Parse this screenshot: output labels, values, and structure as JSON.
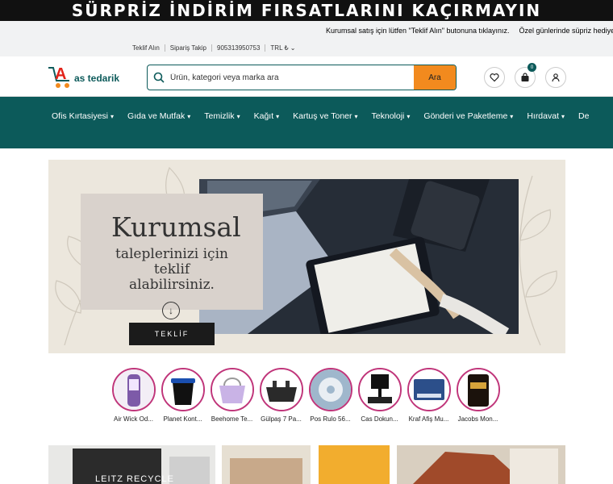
{
  "banner": {
    "text": "SÜRPRİZ İNDİRİM FIRSATLARINI KAÇIRMAYIN"
  },
  "ticker": [
    {
      "text": "Kurumsal satış için lütfen \"Teklif Alın\" butonuna tıklayınız."
    },
    {
      "text": "Özel günlerinde süpriz hediye"
    }
  ],
  "toplinks": [
    {
      "label": "Teklif Alın"
    },
    {
      "label": "Sipariş Takip"
    },
    {
      "label": "905313950753"
    },
    {
      "label": "TRL ₺"
    }
  ],
  "logo": {
    "text": "as tedarik"
  },
  "search": {
    "placeholder": "Ürün, kategori veya marka ara",
    "button": "Ara"
  },
  "cart": {
    "count": "0"
  },
  "nav": [
    {
      "label": "Ofis Kırtasiyesi"
    },
    {
      "label": "Gıda ve Mutfak"
    },
    {
      "label": "Temizlik"
    },
    {
      "label": "Kağıt"
    },
    {
      "label": "Kartuş ve Toner"
    },
    {
      "label": "Teknoloji"
    },
    {
      "label": "Gönderi ve Paketleme"
    },
    {
      "label": "Hırdavat"
    },
    {
      "label": "De"
    }
  ],
  "hero": {
    "title": "Kurumsal",
    "line1": "taleplerinizi için",
    "line2": "teklif",
    "line3": "alabilirsiniz.",
    "button": "TEKLİF"
  },
  "categories": [
    {
      "label": "Air Wick Od..."
    },
    {
      "label": "Planet Kont..."
    },
    {
      "label": "Beehome Te..."
    },
    {
      "label": "Gülpaş 7 Pa..."
    },
    {
      "label": "Pos Rulo 56..."
    },
    {
      "label": "Cas Dokun..."
    },
    {
      "label": "Kraf Afiş Mu..."
    },
    {
      "label": "Jacobs Mon..."
    }
  ],
  "tiles": {
    "first": "LEITZ RECYCLE"
  },
  "colors": {
    "primary": "#0c5a5a",
    "accent": "#f28a1e",
    "ring": "#c0357a"
  }
}
